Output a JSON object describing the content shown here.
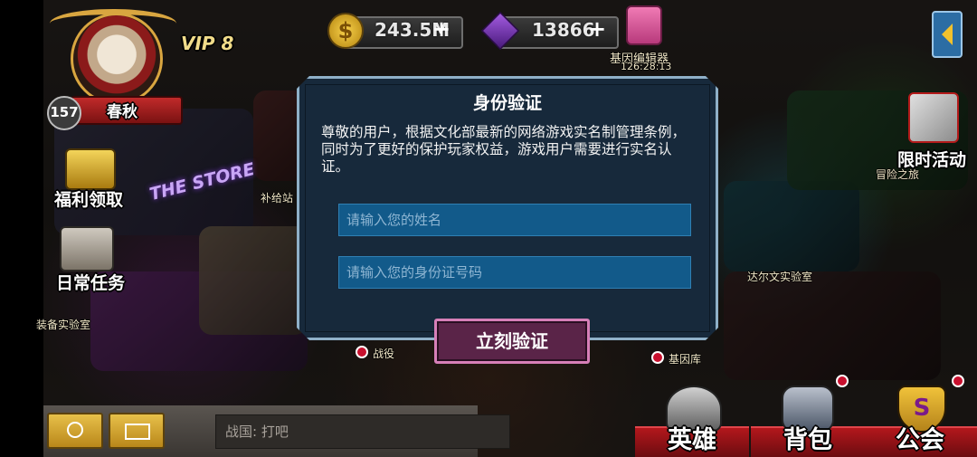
{
  "player": {
    "level": "157",
    "name": "春秋",
    "vip": "VIP 8"
  },
  "resources": {
    "coins": "243.5M",
    "gems": "13866"
  },
  "gene_editor": {
    "label": "基因编辑器",
    "timer": "126:28:13"
  },
  "left_menu": {
    "welfare": "福利领取",
    "daily": "日常任务",
    "equip_lab": "装备实验室"
  },
  "map_labels": {
    "store_sign": "THE STORE",
    "supply": "补给站",
    "battle": "战役",
    "gene_bank": "基因库",
    "darwin_lab": "达尔文实验室",
    "adventure": "冒险之旅"
  },
  "right_menu": {
    "limited_event": "限时活动"
  },
  "dialog": {
    "title": "身份验证",
    "message": "尊敬的用户，根据文化部最新的网络游戏实名制管理条例，同时为了更好的保护玩家权益，游戏用户需要进行实名认证。",
    "name_placeholder": "请输入您的姓名",
    "id_placeholder": "请输入您的身份证号码",
    "verify_button": "立刻验证"
  },
  "chat": {
    "text": "战国: 打吧"
  },
  "bottom_tabs": {
    "hero": "英雄",
    "bag": "背包",
    "guild": "公会"
  },
  "colors": {
    "dialog_bg": "#17293b",
    "input_bg": "#125a8a",
    "button_bg": "#5a2448",
    "button_border": "#d77fb8",
    "tab_red": "#b3171c"
  }
}
